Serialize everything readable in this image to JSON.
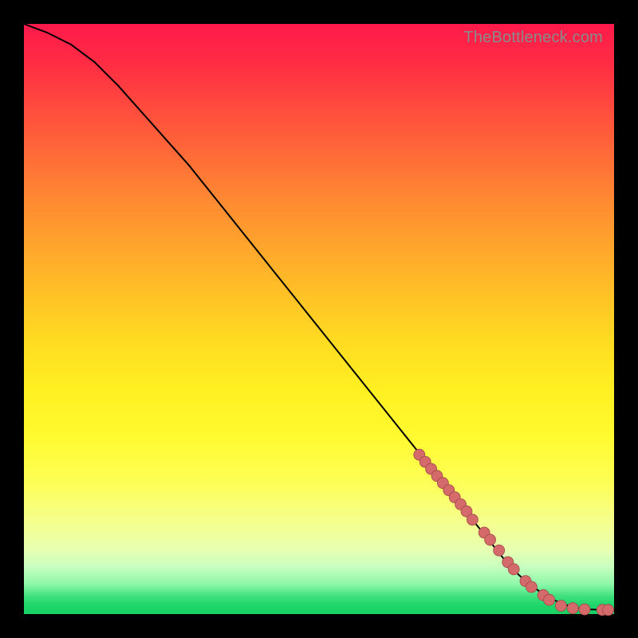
{
  "watermark": "TheBottleneck.com",
  "colors": {
    "frame": "#000000",
    "curve": "#000000",
    "dot_fill": "#d46a6a",
    "dot_stroke": "#a04848",
    "gradient_top": "#ff1a4b",
    "gradient_bottom": "#18d064"
  },
  "chart_data": {
    "type": "line",
    "title": "",
    "xlabel": "",
    "ylabel": "",
    "xlim": [
      0,
      100
    ],
    "ylim": [
      0,
      100
    ],
    "grid": false,
    "legend": false,
    "note": "Axes are unlabeled in source image; x/y values are estimated in percent of plot width/height. y is plotted with origin at bottom (0) to top (100).",
    "series": [
      {
        "name": "curve",
        "kind": "line",
        "x": [
          0,
          4,
          8,
          12,
          16,
          20,
          24,
          28,
          32,
          36,
          40,
          44,
          48,
          52,
          56,
          60,
          64,
          68,
          72,
          76,
          80,
          82,
          84,
          86,
          88,
          90,
          92,
          94,
          96,
          98,
          100
        ],
        "y": [
          100,
          98.5,
          96.5,
          93.5,
          89.5,
          85,
          80.5,
          76,
          71,
          66,
          61,
          56,
          51,
          46,
          41,
          36,
          31,
          26,
          21,
          16,
          11,
          8.5,
          6.5,
          4.8,
          3.4,
          2.3,
          1.5,
          1.0,
          0.8,
          0.7,
          0.7
        ]
      },
      {
        "name": "points",
        "kind": "scatter",
        "x": [
          67,
          68,
          69,
          70,
          71,
          72,
          73,
          74,
          75,
          76,
          78,
          79,
          80.5,
          82,
          83,
          85,
          86,
          88,
          89,
          91,
          93,
          95,
          98,
          99
        ],
        "y": [
          27,
          25.8,
          24.6,
          23.4,
          22.2,
          21,
          19.8,
          18.6,
          17.4,
          16,
          13.8,
          12.6,
          10.8,
          8.8,
          7.6,
          5.6,
          4.6,
          3.2,
          2.4,
          1.4,
          1.0,
          0.8,
          0.7,
          0.7
        ]
      }
    ]
  }
}
